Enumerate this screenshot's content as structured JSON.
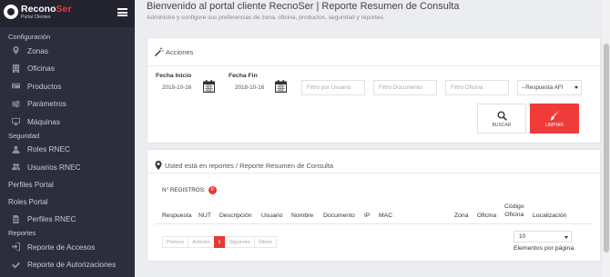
{
  "brand": {
    "name_1": "Recono",
    "name_2": "Ser",
    "subtitle": "Portal Clientes"
  },
  "sidebar": {
    "sections": {
      "configuracion": "Configuración",
      "seguridad": "Seguridad",
      "perfiles_portal": "Perfiles Portal",
      "roles_portal": "Roles Portal",
      "reportes": "Reportes"
    },
    "items": {
      "zonas": "Zonas",
      "oficinas": "Oficinas",
      "productos": "Productos",
      "parametros": "Parámetros",
      "maquinas": "Máquinas",
      "roles_rnec": "Roles RNEC",
      "usuarios_rnec": "Usuarios RNEC",
      "perfiles_rnec": "Perfiles RNEC",
      "reporte_accesos": "Reporte de Accesos",
      "reporte_autorizaciones": "Reporte de Autorizaciones"
    }
  },
  "header": {
    "title": "Bienvenido al portal cliente RecnoSer | Reporte Resumen de Consulta",
    "subtitle": "Administre y configure sus preferencias de zona, oficina, productos, seguridad y reportes."
  },
  "acciones": {
    "title": "Acciones",
    "fecha_inicio_label": "Fecha Inicio",
    "fecha_inicio_value": "2018-10-16",
    "fecha_fin_label": "Fecha Fin",
    "fecha_fin_value": "2018-10-16",
    "filtro_usuario_placeholder": "Filtro por Usuario",
    "filtro_documento_placeholder": "Filtro Documento",
    "filtro_oficina_placeholder": "Filtro Oficina",
    "respuesta_select": "--Respuesta AFI",
    "buscar_label": "BUSCAR",
    "limpiar_label": "LIMPIAR"
  },
  "reporte": {
    "breadcrumb": "Usted está en reportes / Reporte Resumen de Consulta",
    "registros_label": "N° REGISTROS:",
    "registros_count": "0",
    "columns": {
      "respuesta": "Respuesta",
      "nut": "NUT",
      "descripcion": "Descripción",
      "usuario": "Usuario",
      "nombre": "Nombre",
      "documento": "Documento",
      "ip": "IP",
      "mac": "MAC",
      "zona": "Zona",
      "oficina": "Oficina",
      "codigo_oficina_1": "Código",
      "codigo_oficina_2": "Oficina",
      "localizacion": "Localización"
    },
    "pager": {
      "primero": "Primero",
      "anterior": "Anterior",
      "current": "1",
      "siguiente": "Siguiente",
      "ultimo": "Último"
    },
    "per_page_value": "10",
    "per_page_label": "Elementos por página."
  }
}
